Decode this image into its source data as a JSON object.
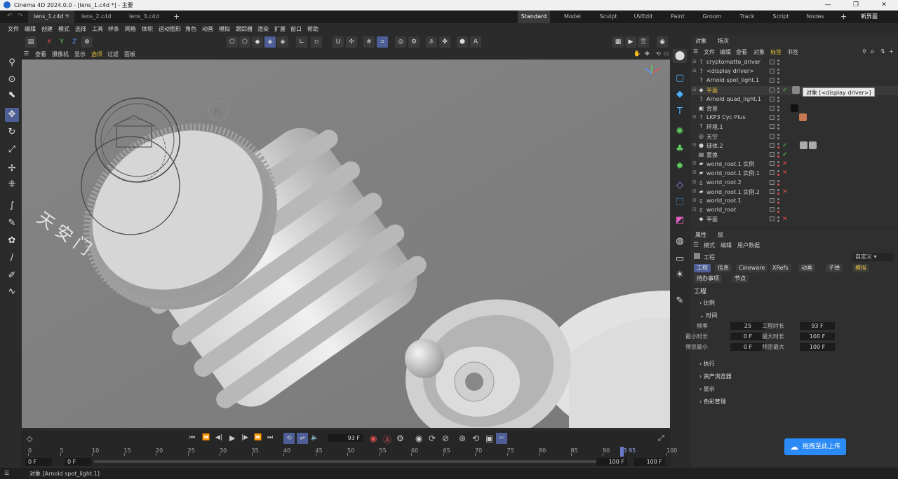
{
  "window": {
    "title": "Cinema 4D 2024.0.0 - [lens_1.c4d *] - 主要"
  },
  "file_tabs": [
    {
      "label": "lens_1.c4d *",
      "active": true
    },
    {
      "label": "lens_2.c4d",
      "active": false
    },
    {
      "label": "lens_3.c4d",
      "active": false
    }
  ],
  "add_tab_label": "+",
  "layouts": [
    "Standard",
    "Model",
    "Sculpt",
    "UVEdit",
    "Paint",
    "Groom",
    "Track",
    "Script",
    "Nodes"
  ],
  "active_layout": "Standard",
  "new_interface_label": "新界面",
  "menus": [
    "文件",
    "编辑",
    "创建",
    "模式",
    "选择",
    "工具",
    "样条",
    "网格",
    "体积",
    "运动图形",
    "角色",
    "动画",
    "模拟",
    "跟踪器",
    "渲染",
    "扩展",
    "窗口",
    "帮助"
  ],
  "axis_buttons": {
    "x": "X",
    "y": "Y",
    "z": "Z"
  },
  "viewport_menu": [
    "查看",
    "摄像机",
    "显示",
    "选项",
    "过滤",
    "面板"
  ],
  "viewport_texts": {
    "chinese_mark": "天 安 门",
    "registered": "R"
  },
  "object_panel": {
    "tabs": [
      "对象",
      "场次"
    ],
    "menu": [
      "文件",
      "编辑",
      "查看",
      "对象",
      "标签",
      "书签"
    ],
    "objects": [
      {
        "name": "cryptomatte_driver",
        "icon": "?",
        "expand": "⊞"
      },
      {
        "name": "<display driver>",
        "icon": "?",
        "expand": "⊞"
      },
      {
        "name": "Arnold spot_light.1",
        "icon": "?",
        "expand": ""
      },
      {
        "name": "平面",
        "icon": "◆",
        "expand": "⊟",
        "highlight": true
      },
      {
        "name": "Arnold quad_light.1",
        "icon": "?",
        "expand": ""
      },
      {
        "name": "背景",
        "icon": "▣",
        "expand": ""
      },
      {
        "name": "LKP3 Cyc Plus",
        "icon": "?",
        "expand": "⊞"
      },
      {
        "name": "环境.1",
        "icon": "?",
        "expand": ""
      },
      {
        "name": "天空",
        "icon": "◎",
        "expand": ""
      },
      {
        "name": "球体.2",
        "icon": "●",
        "expand": "⊟"
      },
      {
        "name": "置换",
        "icon": "▤",
        "expand": ""
      },
      {
        "name": "world_root.1 实例",
        "icon": "▰",
        "expand": "⊞"
      },
      {
        "name": "world_root.1 实例.1",
        "icon": "▰",
        "expand": "⊞"
      },
      {
        "name": "world_root.2",
        "icon": "▯",
        "expand": "⊞"
      },
      {
        "name": "world_root.1 实例.2",
        "icon": "▰",
        "expand": "⊞"
      },
      {
        "name": "world_root.1",
        "icon": "▯",
        "expand": "⊞"
      },
      {
        "name": "world_root",
        "icon": "▯",
        "expand": "⊟"
      },
      {
        "name": "平面",
        "icon": "◆",
        "expand": ""
      }
    ],
    "tooltip": "对象 [<display driver>]"
  },
  "attributes_panel": {
    "tabs": [
      "属性",
      "层"
    ],
    "menu": [
      "模式",
      "编辑",
      "用户数据"
    ],
    "header": "工程",
    "dropdown": "自定义",
    "tab_buttons": [
      "工程",
      "信息",
      "Cineware",
      "XRefs",
      "动画",
      "子弹",
      "模拟",
      "待办事项",
      "节点"
    ],
    "section_title": "工程",
    "sections": [
      "比例",
      "时间",
      "执行",
      "资产浏览器",
      "显示",
      "色彩管理"
    ],
    "time_fields": [
      {
        "label": "帧率",
        "value": "25",
        "label2": "工程时长",
        "value2": "93 F"
      },
      {
        "label": "最小时长",
        "value": "0 F",
        "label2": "最大时长",
        "value2": "100 F"
      },
      {
        "label": "预览最小",
        "value": "0 F",
        "label2": "预览最大",
        "value2": "100 F"
      }
    ]
  },
  "timeline": {
    "current_frame": "93 F",
    "ruler_ticks": [
      "0",
      "5",
      "10",
      "15",
      "20",
      "25",
      "30",
      "35",
      "40",
      "45",
      "50",
      "55",
      "60",
      "65",
      "70",
      "75",
      "80",
      "85",
      "90",
      "93 95",
      "100"
    ],
    "start_field": "0 F",
    "start_field2": "0 F",
    "end_field": "100 F",
    "end_field2": "100 F"
  },
  "upload_button": "拖拽至此上传",
  "status": "对象 [Arnold spot_light.1]"
}
